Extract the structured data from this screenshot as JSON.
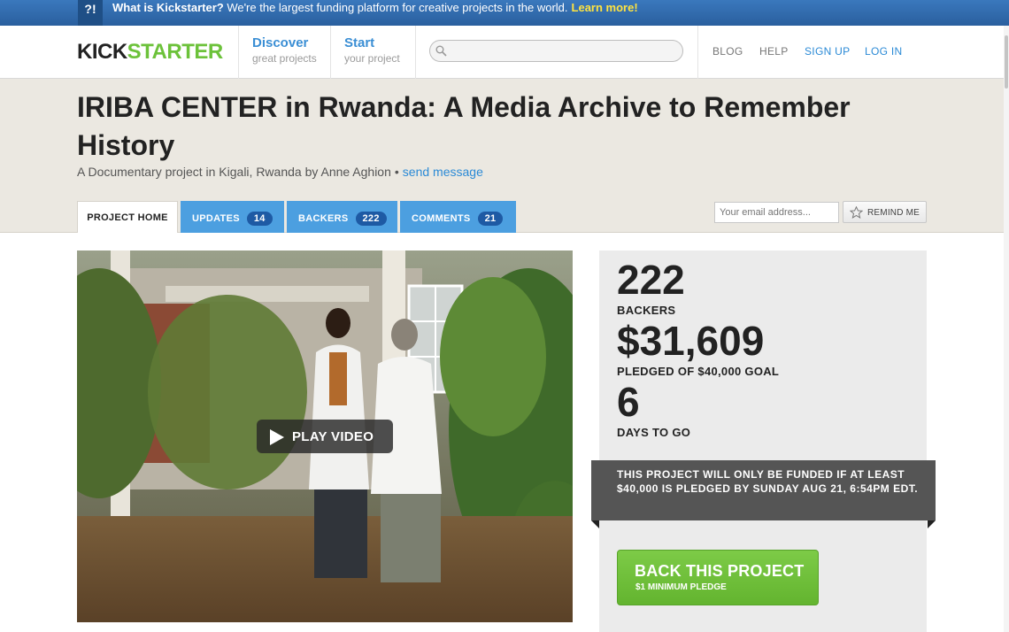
{
  "banner": {
    "badge": "?!",
    "question": "What is Kickstarter?",
    "text": " We're the largest funding platform for creative projects in the world.",
    "learn_more": "Learn more!"
  },
  "header": {
    "logo_part1": "KICK",
    "logo_part2": "STARTER",
    "discover_title": "Discover",
    "discover_sub": "great projects",
    "start_title": "Start",
    "start_sub": "your project",
    "search_placeholder": "",
    "links": {
      "blog": "BLOG",
      "help": "HELP",
      "signup": "SIGN UP",
      "login": "LOG IN"
    }
  },
  "project": {
    "title": "IRIBA CENTER in Rwanda: A Media Archive to Remember History",
    "byline": "A Documentary project in Kigali, Rwanda by Anne Aghion",
    "bullet": "•",
    "send_message": "send message"
  },
  "tabs": {
    "home": "PROJECT HOME",
    "updates": "UPDATES",
    "updates_count": "14",
    "backers": "BACKERS",
    "backers_count": "222",
    "comments": "COMMENTS",
    "comments_count": "21"
  },
  "remind": {
    "email_placeholder": "Your email address...",
    "button": "REMIND ME"
  },
  "video": {
    "play_label": "PLAY VIDEO"
  },
  "stats": {
    "backers_num": "222",
    "backers_label": "BACKERS",
    "pledged_num": "$31,609",
    "pledged_label": "PLEDGED OF $40,000 GOAL",
    "days_num": "6",
    "days_label": "DAYS TO GO",
    "funding_note": "THIS PROJECT WILL ONLY BE FUNDED IF AT LEAST $40,000 IS PLEDGED BY SUNDAY AUG 21, 6:54PM EDT."
  },
  "cta": {
    "main": "BACK THIS PROJECT",
    "sub": "$1 MINIMUM PLEDGE"
  },
  "colors": {
    "brand_green": "#6cc23a",
    "link_blue": "#2b8ad6",
    "tab_blue": "#4c9fe0",
    "banner_blue": "#2e6bb0"
  }
}
